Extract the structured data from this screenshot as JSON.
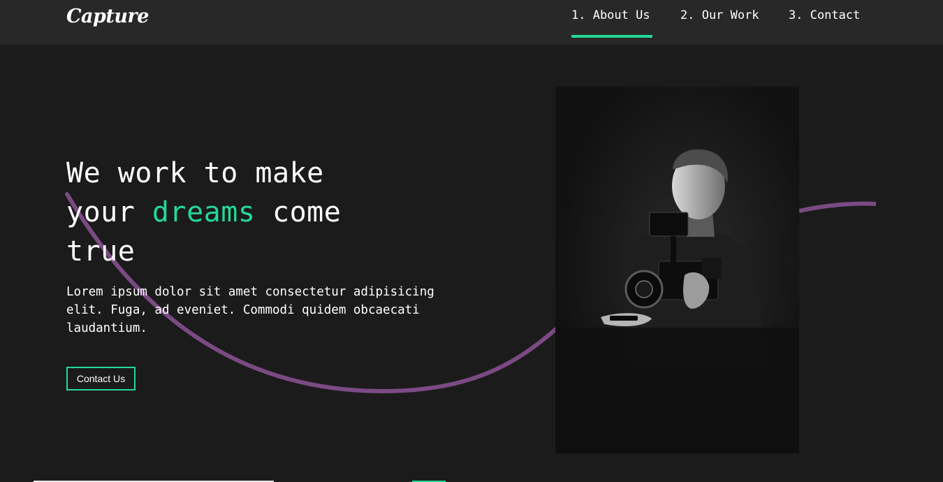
{
  "brand": {
    "logo": "Capture"
  },
  "nav": {
    "links": [
      {
        "label": "1. About Us",
        "active": true
      },
      {
        "label": "2. Our Work",
        "active": false
      },
      {
        "label": "3. Contact",
        "active": false
      }
    ]
  },
  "hero": {
    "title_line1": "We work to make",
    "title_line2_before": "your ",
    "title_line2_accent": "dreams",
    "title_line2_after": " come",
    "title_line3": "true",
    "description": "Lorem ipsum dolor sit amet consectetur adipisicing elit. Fuga, ad eveniet. Commodi quidem obcaecati laudantium.",
    "cta_label": "Contact Us"
  },
  "colors": {
    "accent": "#23d997",
    "wave": "#7b4a83",
    "background": "#1b1b1b",
    "navbar": "#282828"
  },
  "media": {
    "hero_photo": "videographer-with-camera-icon"
  }
}
